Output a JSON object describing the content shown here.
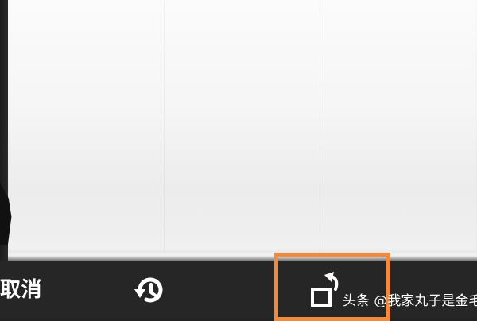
{
  "screen": {
    "description_hidden": false,
    "accent_color": "#f28a3c",
    "background_color": "#262626"
  },
  "toolbar": {
    "cancel_label": "取消",
    "history_icon": "history-icon",
    "rotate_icon": "rotate-icon"
  },
  "watermark": {
    "text": "头条 @我家丸子是金毛"
  }
}
